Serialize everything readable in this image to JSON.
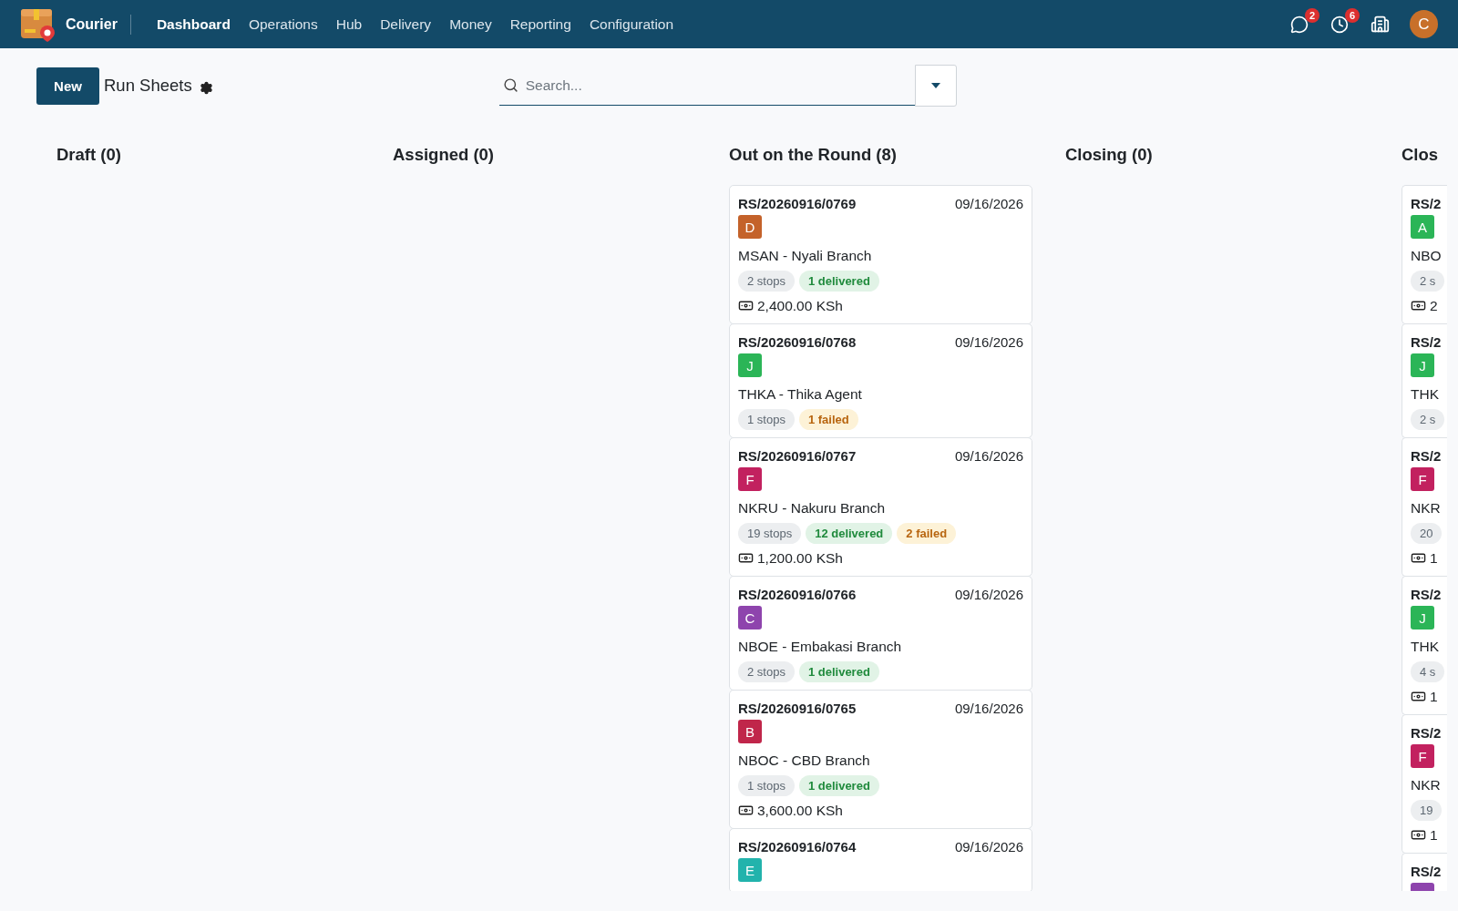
{
  "app": {
    "name": "Courier"
  },
  "nav": [
    {
      "label": "Dashboard",
      "selected": true
    },
    {
      "label": "Operations",
      "selected": false
    },
    {
      "label": "Hub",
      "selected": false
    },
    {
      "label": "Delivery",
      "selected": false
    },
    {
      "label": "Money",
      "selected": false
    },
    {
      "label": "Reporting",
      "selected": false
    },
    {
      "label": "Configuration",
      "selected": false
    }
  ],
  "systray": [
    {
      "kind": "chat",
      "badge": "2"
    },
    {
      "kind": "clock",
      "badge": "6"
    },
    {
      "kind": "building"
    }
  ],
  "user": {
    "initial": "C"
  },
  "control": {
    "new_button": "New",
    "title": "Run Sheets",
    "search": {
      "placeholder": "Search..."
    }
  },
  "columns": [
    {
      "title": "Draft (0)"
    },
    {
      "title": "Assigned (0)"
    },
    {
      "title": "Out on the Round (8)",
      "cards": [
        {
          "ref": "RS/20260916/0769",
          "date": "09/16/2026",
          "avatar": {
            "letter": "D",
            "color": "#c4622a"
          },
          "location": "MSAN - Nyali Branch",
          "tags": [
            {
              "kind": "stops",
              "text": "2 stops"
            },
            {
              "kind": "delivered",
              "text": "1 delivered"
            }
          ],
          "amount": "2,400.00 KSh"
        },
        {
          "ref": "RS/20260916/0768",
          "date": "09/16/2026",
          "avatar": {
            "letter": "J",
            "color": "#2bb557"
          },
          "location": "THKA - Thika Agent",
          "tags": [
            {
              "kind": "stops",
              "text": "1 stops"
            },
            {
              "kind": "failed",
              "text": "1 failed"
            }
          ]
        },
        {
          "ref": "RS/20260916/0767",
          "date": "09/16/2026",
          "avatar": {
            "letter": "F",
            "color": "#c2215f"
          },
          "location": "NKRU - Nakuru Branch",
          "tags": [
            {
              "kind": "stops",
              "text": "19 stops"
            },
            {
              "kind": "delivered",
              "text": "12 delivered"
            },
            {
              "kind": "failed",
              "text": "2 failed"
            }
          ],
          "amount": "1,200.00 KSh"
        },
        {
          "ref": "RS/20260916/0766",
          "date": "09/16/2026",
          "avatar": {
            "letter": "C",
            "color": "#8e44ad"
          },
          "location": "NBOE - Embakasi Branch",
          "tags": [
            {
              "kind": "stops",
              "text": "2 stops"
            },
            {
              "kind": "delivered",
              "text": "1 delivered"
            }
          ]
        },
        {
          "ref": "RS/20260916/0765",
          "date": "09/16/2026",
          "avatar": {
            "letter": "B",
            "color": "#c0264a"
          },
          "location": "NBOC - CBD Branch",
          "tags": [
            {
              "kind": "stops",
              "text": "1 stops"
            },
            {
              "kind": "delivered",
              "text": "1 delivered"
            }
          ],
          "amount": "3,600.00 KSh"
        },
        {
          "ref": "RS/20260916/0764",
          "date": "09/16/2026",
          "avatar": {
            "letter": "E",
            "color": "#22b3ac"
          }
        }
      ]
    },
    {
      "title": "Closing (0)"
    },
    {
      "title": "Clos",
      "cards": [
        {
          "ref": "RS/2",
          "avatar": {
            "letter": "A",
            "color": "#2bb557"
          },
          "location": "NBO",
          "tags": [
            {
              "kind": "stops",
              "text": "2 s"
            }
          ],
          "amount": "2"
        },
        {
          "ref": "RS/2",
          "avatar": {
            "letter": "J",
            "color": "#2bb557"
          },
          "location": "THK",
          "tags": [
            {
              "kind": "stops",
              "text": "2 s"
            }
          ]
        },
        {
          "ref": "RS/2",
          "avatar": {
            "letter": "F",
            "color": "#c2215f"
          },
          "location": "NKR",
          "tags": [
            {
              "kind": "stops",
              "text": "20"
            }
          ],
          "amount": "1"
        },
        {
          "ref": "RS/2",
          "avatar": {
            "letter": "J",
            "color": "#2bb557"
          },
          "location": "THK",
          "tags": [
            {
              "kind": "stops",
              "text": "4 s"
            }
          ],
          "amount": "1"
        },
        {
          "ref": "RS/2",
          "avatar": {
            "letter": "F",
            "color": "#c2215f"
          },
          "location": "NKR",
          "tags": [
            {
              "kind": "stops",
              "text": "19"
            }
          ],
          "amount": "1"
        },
        {
          "ref": "RS/2",
          "avatar": {
            "color": "#8e44ad"
          }
        }
      ]
    }
  ]
}
